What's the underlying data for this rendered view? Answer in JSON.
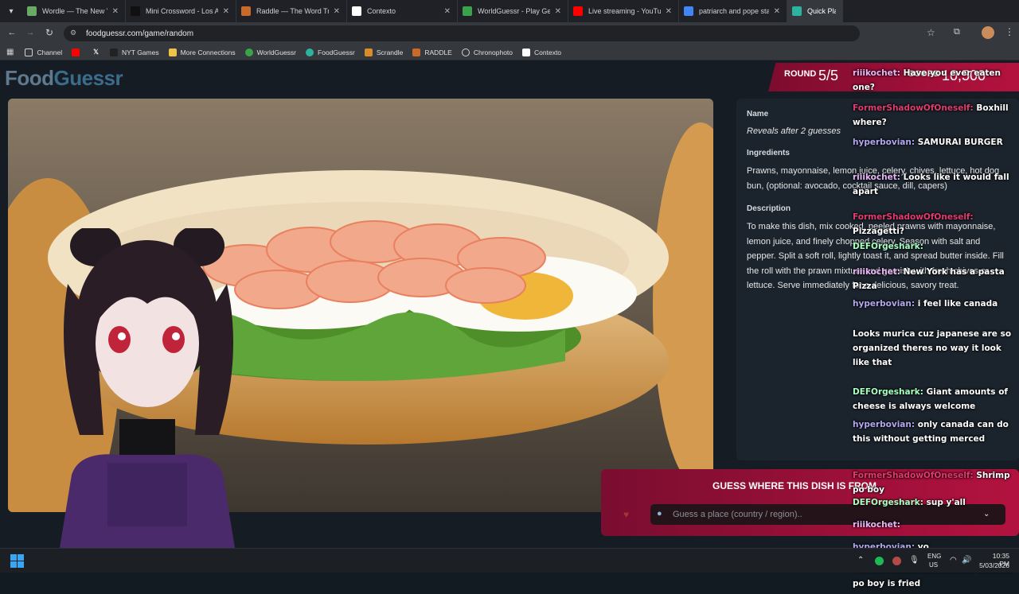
{
  "browser": {
    "tabs": [
      {
        "title": "Wordle — The New York",
        "color": "#6aaa64"
      },
      {
        "title": "Mini Crossword - Los Ang",
        "color": "#111111"
      },
      {
        "title": "Raddle — The Word Tran",
        "color": "#c76a2a"
      },
      {
        "title": "Contexto",
        "color": "#ffffff"
      },
      {
        "title": "WorldGuessr - Play Geogr",
        "color": "#3aa34a"
      },
      {
        "title": "Live streaming - YouTube",
        "color": "#ff0000"
      },
      {
        "title": "patriarch and pope state",
        "color": "#4285f4"
      },
      {
        "title": "Quick Play - Foo",
        "color": "#2bb3a0"
      }
    ],
    "url": "foodguessr.com/game/random",
    "bookmarks": [
      "Channel",
      "",
      "NYT Games",
      "More Connections",
      "WorldGuessr",
      "FoodGuessr",
      "Scrandle",
      "RADDLE",
      "Chronophoto",
      "Contexto"
    ]
  },
  "game": {
    "logo_part1": "Food",
    "logo_part2": "Guessr",
    "round_label": "ROUND",
    "round_value": "5/5",
    "score_label": "SCORE",
    "score_value": "10,500",
    "info": {
      "name_heading": "Name",
      "name_value": "Reveals after 2 guesses",
      "ingredients_heading": "Ingredients",
      "ingredients_value": "Prawns, mayonnaise, lemon juice, celery, chives, lettuce, hot dog bun, (optional: avocado, cocktail sauce, dill, capers)",
      "description_heading": "Description",
      "description_value": "To make this dish, mix cooked, peeled prawns with mayonnaise, lemon juice, and finely chopped celery. Season with salt and pepper. Split a soft roll, lightly toast it, and spread butter inside. Fill the roll with the prawn mixture and garnish with fresh chives or lettuce. Serve immediately for a delicious, savory treat."
    },
    "guess_title": "GUESS WHERE THIS DISH IS FROM",
    "guess_placeholder": "Guess a place (country / region)..",
    "colors": {
      "accent": "#b3123f",
      "logo": "#3c6c8c"
    }
  },
  "chat": [
    {
      "user": "riiikochet",
      "cls": "u-rii",
      "text": "Have you ever eaten one?",
      "top": 0
    },
    {
      "user": "FormerShadowOfOneself",
      "cls": "u-former",
      "text": "Boxhill where?",
      "top": 0
    },
    {
      "user": "hyperbovian",
      "cls": "u-hyp",
      "text": "SAMURAI BURGER",
      "top": 0
    },
    {
      "user": "riiikochet",
      "cls": "u-rii",
      "text": "Looks like it would fall apart",
      "top": 0
    },
    {
      "user": "FormerShadowOfOneself",
      "cls": "u-former",
      "text": "Pizzagetti?",
      "top": 0
    },
    {
      "user": "DEFOrgeshark",
      "cls": "u-def",
      "text": "",
      "top": 0
    },
    {
      "user": "riiikochet",
      "cls": "u-rii",
      "text": "New York has a pasta Pizza",
      "top": 0
    },
    {
      "user": "hyperbovian",
      "cls": "u-hyp",
      "text": "i feel like canada",
      "top": 0
    },
    {
      "user": "",
      "cls": "u-hyp",
      "text": "Looks murica cuz japanese are so organized theres no way it look like that",
      "top": 0
    },
    {
      "user": "DEFOrgeshark",
      "cls": "u-def",
      "text": "Giant amounts of cheese is always welcome",
      "top": 0
    },
    {
      "user": "hyperbovian",
      "cls": "u-hyp",
      "text": "only canada can do this without getting merced",
      "top": 0
    },
    {
      "user": "FormerShadowOfOneself",
      "cls": "u-former",
      "text": "Shrimp po boy",
      "top": 0
    },
    {
      "user": "DEFOrgeshark",
      "cls": "u-def",
      "text": "sup y'all",
      "top": 0
    },
    {
      "user": "riiikochet",
      "cls": "u-rii",
      "text": "",
      "top": 0
    },
    {
      "user": "hyperbovian",
      "cls": "u-hyp",
      "text": "yo",
      "top": 0
    },
    {
      "user": "FormerShadowOfOneself",
      "cls": "u-former",
      "text": "Wait no po boy is fried",
      "top": 0
    }
  ],
  "taskbar": {
    "lang_top": "ENG",
    "lang_bottom": "US",
    "time": "10:35 PM",
    "date": "5/03/2026"
  }
}
